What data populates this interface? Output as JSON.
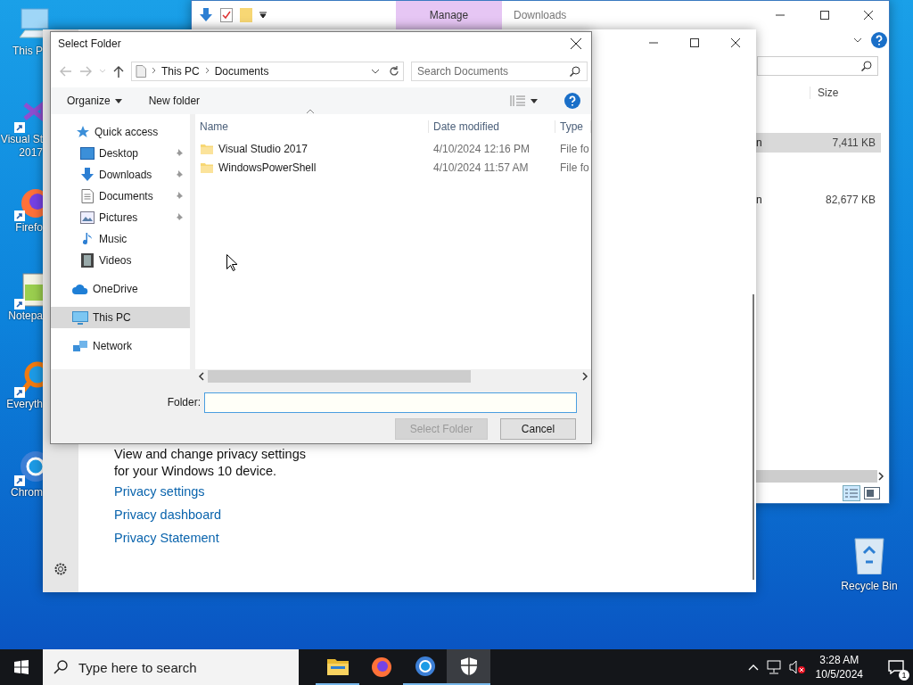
{
  "desktop_icons": [
    {
      "kind": "pc",
      "lines": [
        "This P"
      ]
    },
    {
      "kind": "vs",
      "lines": [
        "Visual St",
        "2017"
      ]
    },
    {
      "kind": "firefox",
      "lines": [
        "Firefo"
      ]
    },
    {
      "kind": "notepad",
      "lines": [
        "Notepa"
      ]
    },
    {
      "kind": "everything",
      "lines": [
        "Everyth"
      ]
    },
    {
      "kind": "chrome",
      "lines": [
        "Chrom"
      ]
    }
  ],
  "recycle_bin": {
    "label": "Recycle Bin"
  },
  "explorer": {
    "ribbon_tab": "Manage",
    "title": "Downloads",
    "columns": [
      "Size"
    ],
    "rows": [
      {
        "column_1": "n",
        "size": "7,411 KB",
        "selected": true
      },
      {
        "column_1": "n",
        "size": "82,677 KB",
        "selected": false
      }
    ]
  },
  "settings": {
    "description": "View and change privacy settings for your Windows 10 device.",
    "links": [
      "Privacy settings",
      "Privacy dashboard",
      "Privacy Statement"
    ]
  },
  "dialog": {
    "title": "Select Folder",
    "breadcrumb": [
      "This PC",
      "Documents"
    ],
    "search": {
      "placeholder": "Search Documents"
    },
    "toolbar": [
      {
        "label": "Organize",
        "kind": "menu"
      },
      {
        "label": "New folder",
        "kind": "button"
      }
    ],
    "nav": [
      {
        "label": "Quick access",
        "kind": "star",
        "selected": false,
        "children": [
          {
            "label": "Desktop",
            "kind": "desktop",
            "pinned": true,
            "selected": false
          },
          {
            "label": "Downloads",
            "kind": "downloads",
            "pinned": true,
            "selected": false
          },
          {
            "label": "Documents",
            "kind": "documents",
            "pinned": true,
            "selected": false
          },
          {
            "label": "Pictures",
            "kind": "pictures",
            "pinned": true,
            "selected": false
          },
          {
            "label": "Music",
            "kind": "music",
            "pinned": false,
            "selected": false
          },
          {
            "label": "Videos",
            "kind": "videos",
            "pinned": false,
            "selected": false
          }
        ]
      },
      {
        "label": "OneDrive",
        "kind": "cloud",
        "selected": false
      },
      {
        "label": "This PC",
        "kind": "pc",
        "selected": true
      },
      {
        "label": "Network",
        "kind": "network",
        "selected": false
      }
    ],
    "columns": [
      "Name",
      "Date modified",
      "Type"
    ],
    "rows": [
      {
        "name": "Visual Studio 2017",
        "date": "4/10/2024 12:16 PM",
        "type": "File fo"
      },
      {
        "name": "WindowsPowerShell",
        "date": "4/10/2024 11:57 AM",
        "type": "File fo"
      }
    ],
    "folder_label": "Folder:",
    "buttons": [
      {
        "label": "Select Folder",
        "disabled": true
      },
      {
        "label": "Cancel",
        "disabled": false
      }
    ]
  },
  "taskbar": {
    "search": {
      "placeholder": "Type here to search"
    },
    "apps": [
      {
        "kind": "explorer",
        "running": true,
        "active": false
      },
      {
        "kind": "firefox",
        "running": false,
        "active": false
      },
      {
        "kind": "chrome",
        "running": true,
        "active": false
      },
      {
        "kind": "shield",
        "running": true,
        "active": true
      }
    ],
    "time": "3:28 AM",
    "date": "10/5/2024",
    "notifications": "1"
  }
}
